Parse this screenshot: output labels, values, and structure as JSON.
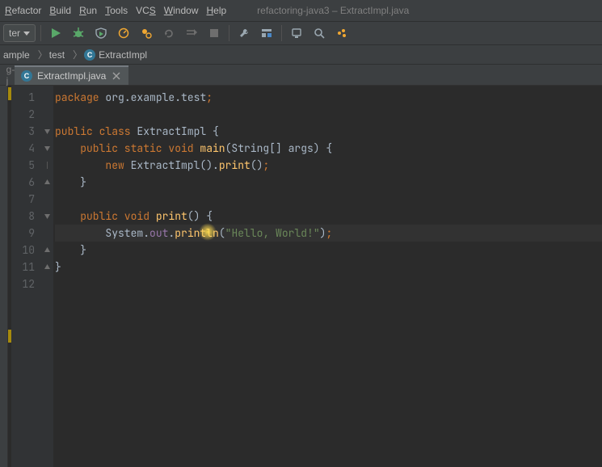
{
  "menubar": {
    "items": [
      "Refactor",
      "Build",
      "Run",
      "Tools",
      "VCS",
      "Window",
      "Help"
    ],
    "mnemonicIndex": [
      0,
      0,
      0,
      0,
      2,
      0,
      0
    ]
  },
  "windowTitle": "refactoring-java3 – ExtractImpl.java",
  "toolbar": {
    "filterLabel": "ter"
  },
  "breadcrumbs": {
    "items": [
      {
        "label": "ample",
        "icon": null
      },
      {
        "label": "test",
        "icon": null
      },
      {
        "label": "ExtractImpl",
        "icon": "class"
      }
    ]
  },
  "tab": {
    "filename": "ExtractImpl.java"
  },
  "sideToolLabel": "g-j",
  "currentLine": 9,
  "code": {
    "lines": [
      {
        "n": 1,
        "tokens": [
          [
            "kw",
            "package "
          ],
          [
            "ident",
            "org"
          ],
          [
            "op",
            "."
          ],
          [
            "ident",
            "example"
          ],
          [
            "op",
            "."
          ],
          [
            "ident",
            "test"
          ],
          [
            "punc",
            ";"
          ]
        ]
      },
      {
        "n": 2,
        "tokens": []
      },
      {
        "n": 3,
        "tokens": [
          [
            "kw",
            "public class "
          ],
          [
            "typ",
            "ExtractImpl "
          ],
          [
            "op",
            "{"
          ]
        ]
      },
      {
        "n": 4,
        "tokens": [
          [
            "ident",
            "    "
          ],
          [
            "kw",
            "public static void "
          ],
          [
            "mtd",
            "main"
          ],
          [
            "op",
            "(String[] args) {"
          ]
        ]
      },
      {
        "n": 5,
        "tokens": [
          [
            "ident",
            "        "
          ],
          [
            "kw",
            "new "
          ],
          [
            "typ",
            "ExtractImpl"
          ],
          [
            "op",
            "()."
          ],
          [
            "mtd",
            "print"
          ],
          [
            "op",
            "()"
          ],
          [
            "punc",
            ";"
          ]
        ]
      },
      {
        "n": 6,
        "tokens": [
          [
            "op",
            "    }"
          ]
        ]
      },
      {
        "n": 7,
        "tokens": []
      },
      {
        "n": 8,
        "tokens": [
          [
            "ident",
            "    "
          ],
          [
            "kw",
            "public void "
          ],
          [
            "mtd",
            "print"
          ],
          [
            "op",
            "() {"
          ]
        ]
      },
      {
        "n": 9,
        "tokens": [
          [
            "ident",
            "        System"
          ],
          [
            "op",
            "."
          ],
          [
            "field",
            "out"
          ],
          [
            "op",
            "."
          ],
          [
            "mtd",
            "println"
          ],
          [
            "op",
            "("
          ],
          [
            "str",
            "\"Hello, World!\""
          ],
          [
            "op",
            ")"
          ],
          [
            "punc",
            ";"
          ]
        ]
      },
      {
        "n": 10,
        "tokens": [
          [
            "op",
            "    }"
          ]
        ]
      },
      {
        "n": 11,
        "tokens": [
          [
            "op",
            "}"
          ]
        ]
      },
      {
        "n": 12,
        "tokens": []
      }
    ],
    "foldMarks": {
      "3": "open-start",
      "4": "open-start",
      "5": "hint",
      "6": "close",
      "8": "open-start",
      "10": "close",
      "11": "close"
    }
  },
  "icons": {
    "run": "run-icon",
    "debug": "debug-icon",
    "coverage": "coverage-icon",
    "profile": "profile-icon",
    "attach": "attach-icon",
    "updateRun": "update-run-icon",
    "execute": "execute-icon",
    "stop": "stop-icon",
    "wrench": "wrench-icon",
    "projStruct": "project-structure-icon",
    "emulator": "emulator-icon",
    "search": "search-icon",
    "ide": "ide-icon"
  }
}
